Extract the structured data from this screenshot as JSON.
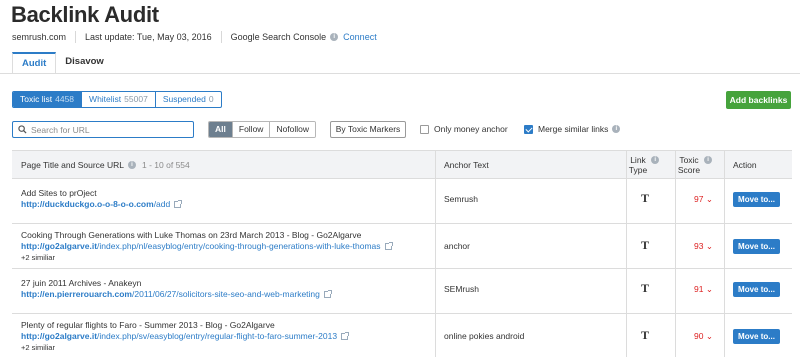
{
  "page": {
    "title": "Backlink Audit",
    "domain": "semrush.com",
    "last_update": "Last update: Tue, May 03, 2016",
    "gsc_label": "Google Search Console",
    "connect": "Connect"
  },
  "tabs": [
    {
      "label": "Audit",
      "active": true
    },
    {
      "label": "Disavow",
      "active": false
    }
  ],
  "lists": [
    {
      "label": "Toxic list",
      "count": "4458",
      "active": true
    },
    {
      "label": "Whitelist",
      "count": "55007",
      "active": false
    },
    {
      "label": "Suspended",
      "count": "0",
      "active": false
    }
  ],
  "add_backlinks": "Add backlinks",
  "search": {
    "placeholder": "Search for URL"
  },
  "filters": [
    {
      "label": "All",
      "active": true
    },
    {
      "label": "Follow",
      "active": false
    },
    {
      "label": "Nofollow",
      "active": false
    }
  ],
  "toxic_markers": "By Toxic Markers",
  "only_money_anchor": {
    "label": "Only money anchor",
    "checked": false
  },
  "merge_similar": {
    "label": "Merge similar links",
    "checked": true
  },
  "table": {
    "col_page": "Page Title and Source URL",
    "range": "1 - 10 of 554",
    "col_anchor": "Anchor Text",
    "col_link_type_1": "Link",
    "col_link_type_2": "Type",
    "col_toxic_1": "Toxic",
    "col_toxic_2": "Score",
    "col_action": "Action",
    "rows": [
      {
        "title": "Add Sites to prOject",
        "url_bold": "http://duckduckgo.o-o-8-o-o.com",
        "url_rest": "/add",
        "similar": "",
        "anchor": "Semrush",
        "type": "T",
        "score": "97",
        "action": "Move to..."
      },
      {
        "title": "Cooking Through Generations with Luke Thomas on 23rd March 2013 - Blog - Go2Algarve",
        "url_bold": "http://go2algarve.it",
        "url_rest": "/index.php/nl/easyblog/entry/cooking-through-generations-with-luke-thomas",
        "similar": "+2 similiar",
        "anchor": "anchor",
        "type": "T",
        "score": "93",
        "action": "Move to..."
      },
      {
        "title": "27 juin 2011 Archives - Anakeyn",
        "url_bold": "http://en.pierrerouarch.com",
        "url_rest": "/2011/06/27/solicitors-site-seo-and-web-marketing",
        "similar": "",
        "anchor": "SEMrush",
        "type": "T",
        "score": "91",
        "action": "Move to..."
      },
      {
        "title": "Plenty of regular flights to Faro - Summer 2013 - Blog - Go2Algarve",
        "url_bold": "http://go2algarve.it",
        "url_rest": "/index.php/sv/easyblog/entry/regular-flight-to-faro-summer-2013",
        "similar": "+2 similiar",
        "anchor": "online pokies android",
        "type": "T",
        "score": "90",
        "action": "Move to..."
      }
    ]
  },
  "colors": {
    "accent": "#2c7cc7",
    "add_button": "#46a33c",
    "toxic_score": "#dd2222",
    "active_filter": "#6d7f8f"
  }
}
